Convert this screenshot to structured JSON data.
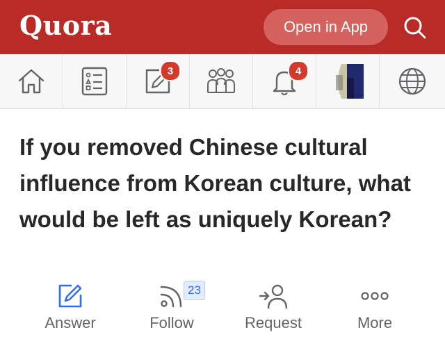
{
  "header": {
    "logo": "Quora",
    "open_app_label": "Open in App",
    "search_icon": "search-icon"
  },
  "nav": {
    "items": [
      {
        "name": "home",
        "icon": "home-icon"
      },
      {
        "name": "following",
        "icon": "list-icon"
      },
      {
        "name": "answer",
        "icon": "edit-icon",
        "badge": "3"
      },
      {
        "name": "spaces",
        "icon": "people-icon"
      },
      {
        "name": "notifications",
        "icon": "bell-icon",
        "badge": "4"
      },
      {
        "name": "profile",
        "icon": "avatar"
      },
      {
        "name": "languages",
        "icon": "globe-icon"
      }
    ]
  },
  "question": {
    "title": "If you removed Chinese cultural influence from Korean culture, what would be left as uniquely Korean?"
  },
  "actions": {
    "answer": {
      "label": "Answer",
      "icon": "pencil-icon"
    },
    "follow": {
      "label": "Follow",
      "icon": "rss-icon",
      "count": "23"
    },
    "request": {
      "label": "Request",
      "icon": "request-user-icon"
    },
    "more": {
      "label": "More",
      "icon": "more-dots-icon"
    }
  },
  "colors": {
    "brand_red": "#b92b27",
    "accent_blue": "#2e69ff",
    "badge_red": "#d33a2c"
  }
}
